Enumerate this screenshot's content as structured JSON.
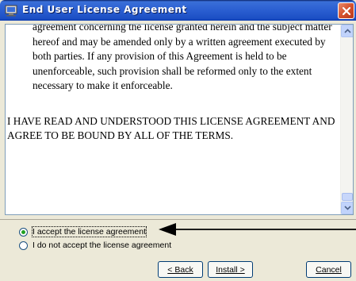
{
  "window": {
    "title": "End User License Agreement"
  },
  "license": {
    "paragraph_partial": "agreement concerning the license granted herein and the subject matter hereof and may be amended only by a written agreement executed by both parties. If any provision of this Agreement is held to be unenforceable, such provision shall be reformed only to the extent necessary to make it enforceable.",
    "terms": "I HAVE READ AND UNDERSTOOD THIS LICENSE AGREEMENT AND AGREE TO BE BOUND BY ALL OF THE TERMS."
  },
  "options": {
    "accept_label": "I accept the license agreement",
    "decline_label": "I do not accept the license agreement",
    "selected": "accept"
  },
  "buttons": {
    "back_label": "< Back",
    "install_label": "Install >",
    "cancel_label": "Cancel"
  },
  "icons": {
    "title_icon": "installer-icon",
    "close": "close-icon"
  }
}
